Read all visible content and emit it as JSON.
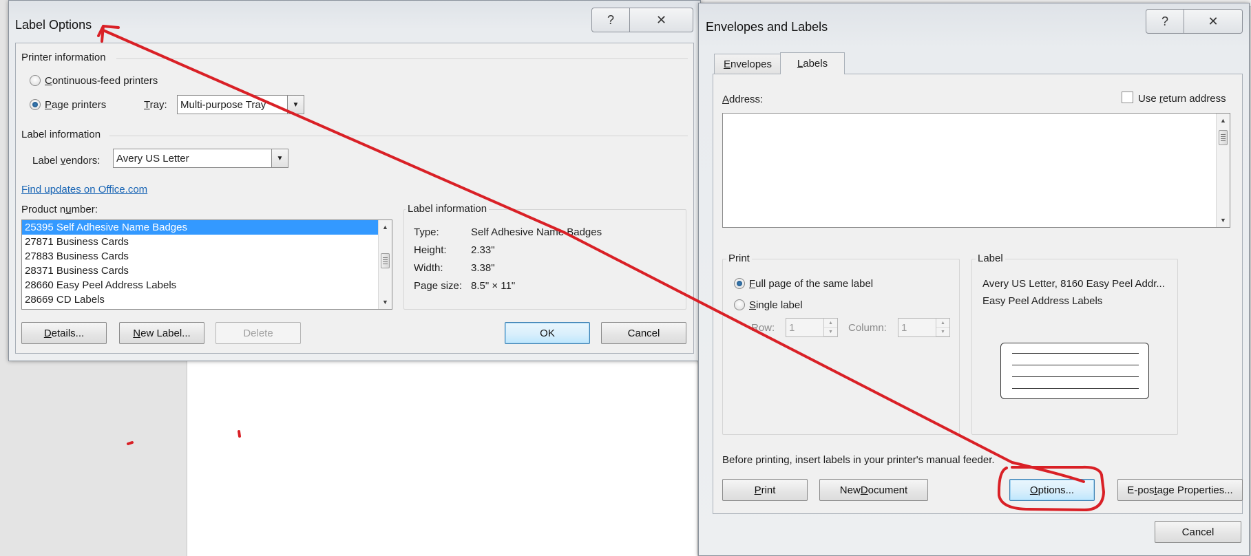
{
  "label_options": {
    "title": "Label Options",
    "title_buttons": {
      "help": "?",
      "close": "✕"
    },
    "printer_section": "Printer information",
    "continuous_feed_label": "Continuous-feed printers",
    "page_printers_label": "Page printers",
    "tray_label": "Tray:",
    "tray_value": "Multi-purpose Tray",
    "label_section": "Label information",
    "vendors_label": "Label vendors:",
    "vendors_value": "Avery US Letter",
    "find_updates_link": "Find updates on Office.com",
    "product_number_label": "Product number:",
    "products": [
      "25395 Self Adhesive Name Badges",
      "27871 Business Cards",
      "27883 Business Cards",
      "28371 Business Cards",
      "28660 Easy Peel Address Labels",
      "28669 CD Labels"
    ],
    "selected_product_index": 0,
    "info_group_title": "Label information",
    "info": {
      "type_label": "Type:",
      "type_value": "Self Adhesive Name Badges",
      "height_label": "Height:",
      "height_value": "2.33\"",
      "width_label": "Width:",
      "width_value": "3.38\"",
      "page_size_label": "Page size:",
      "page_size_value": "8.5\" × 11\""
    },
    "buttons": {
      "details": "Details...",
      "new_label": "New Label...",
      "delete": "Delete",
      "ok": "OK",
      "cancel": "Cancel"
    }
  },
  "envelopes_labels": {
    "title": "Envelopes and Labels",
    "title_buttons": {
      "help": "?",
      "close": "✕"
    },
    "tabs": [
      "Envelopes",
      "Labels"
    ],
    "active_tab": "Labels",
    "address_label": "Address:",
    "use_return_address_label": "Use return address",
    "address_value": "",
    "print_group_title": "Print",
    "full_page_label": "Full page of the same label",
    "single_label_label": "Single label",
    "row_label": "Row:",
    "row_value": "1",
    "column_label": "Column:",
    "column_value": "1",
    "label_group_title": "Label",
    "label_line1": "Avery US Letter, 8160 Easy Peel Addr...",
    "label_line2": "Easy Peel Address Labels",
    "instruction": "Before printing, insert labels in your printer's manual feeder.",
    "buttons": {
      "print": "Print",
      "new_document": "New Document",
      "options": "Options...",
      "epostage": "E-postage Properties...",
      "cancel": "Cancel"
    }
  },
  "annotation_color": "#d92026"
}
